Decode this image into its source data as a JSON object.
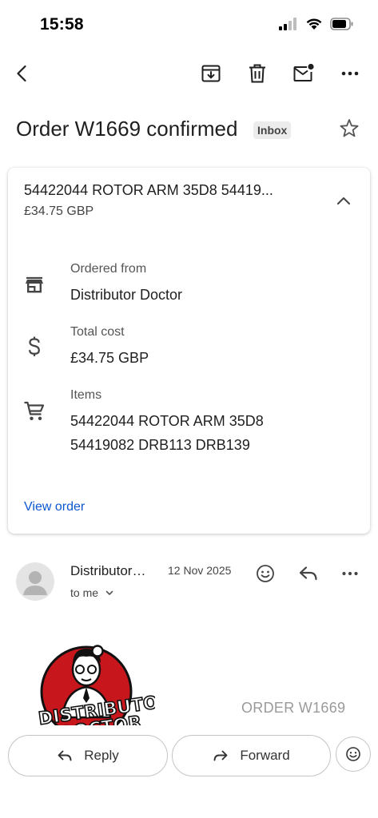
{
  "status_bar": {
    "time": "15:58"
  },
  "toolbar": {
    "icons": [
      "back-icon",
      "archive-icon",
      "delete-icon",
      "mark-unread-icon",
      "more-icon"
    ]
  },
  "email": {
    "subject": "Order W1669 confirmed",
    "label": "Inbox"
  },
  "order_card": {
    "title": "54422044 ROTOR ARM 35D8 54419...",
    "subtitle": "£34.75 GBP",
    "ordered_from_label": "Ordered from",
    "ordered_from_value": "Distributor Doctor",
    "total_cost_label": "Total cost",
    "total_cost_value": "£34.75 GBP",
    "items_label": "Items",
    "items_line_1": "54422044 ROTOR ARM 35D8",
    "items_line_2": "54419082 DRB113 DRB139",
    "view_order": "View order"
  },
  "message": {
    "sender": "Distributor…",
    "date": "12 Nov 2025",
    "recipient": "to me",
    "logo_text_1": "DISTRIBUTOR",
    "logo_text_2": "DOCTOR",
    "order_ref": "ORDER W1669"
  },
  "actions": {
    "reply": "Reply",
    "forward": "Forward"
  },
  "colors": {
    "link": "#0b57d0",
    "badge_bg": "#ececec",
    "logo_red": "#c8161d"
  }
}
